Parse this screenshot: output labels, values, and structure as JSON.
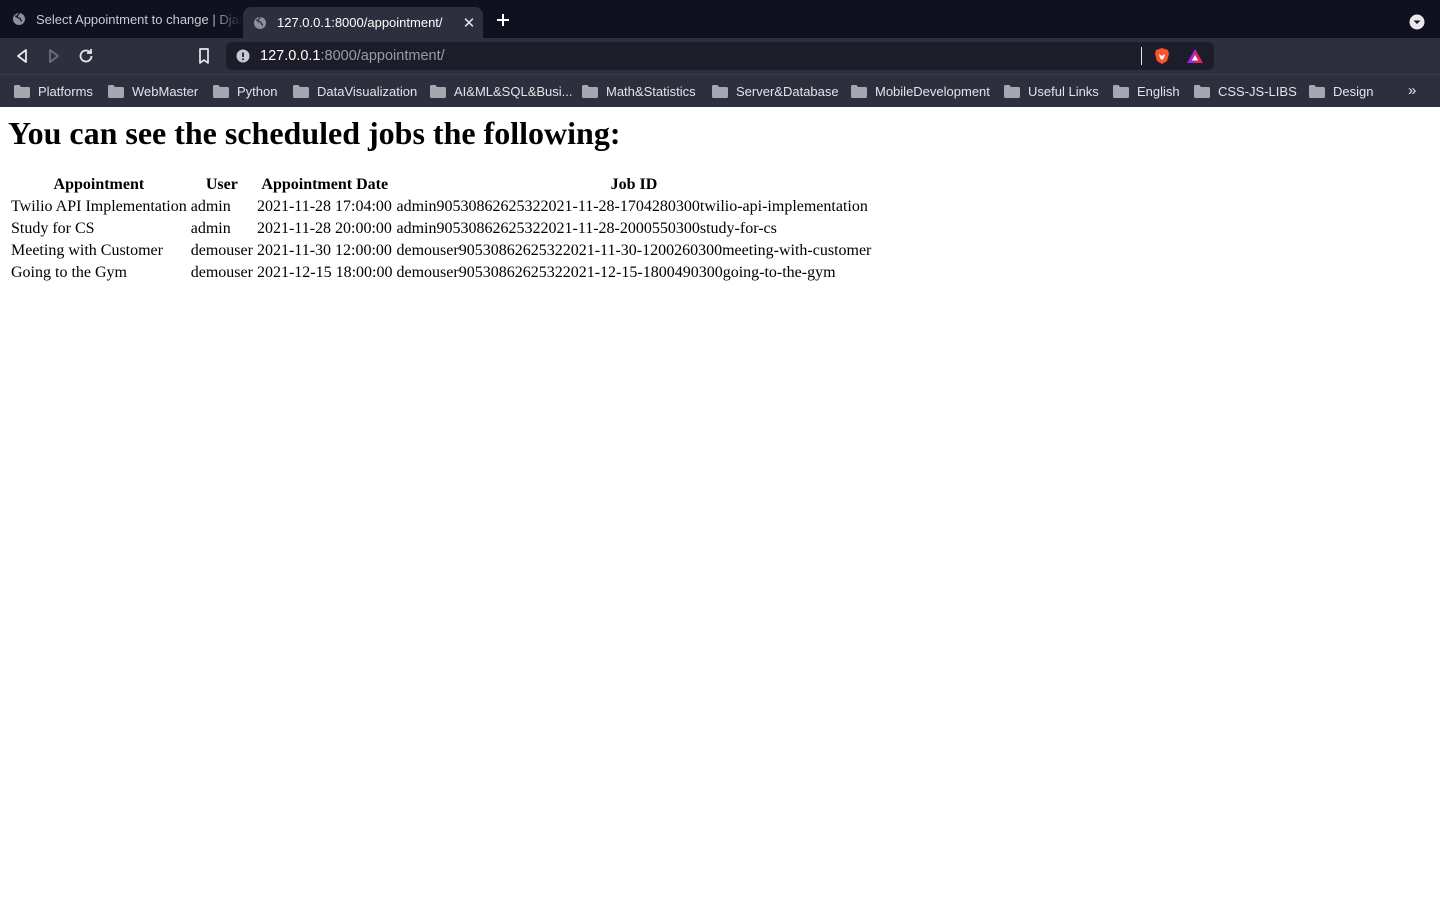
{
  "browser": {
    "tabs": [
      {
        "title": "Select Appointment to change | Django site admin",
        "active": false
      },
      {
        "title": "127.0.0.1:8000/appointment/",
        "active": true
      }
    ],
    "address": {
      "host": "127.0.0.1",
      "rest": ":8000/appointment/"
    },
    "bookmarks": [
      "Platforms",
      "WebMaster",
      "Python",
      "DataVisualization",
      "AI&ML&SQL&Busi...",
      "Math&Statistics",
      "Server&Database",
      "MobileDevelopment",
      "Useful Links",
      "English",
      "CSS-JS-LIBS",
      "Design"
    ],
    "colors": {
      "tabstrip": "#0f1020",
      "toolbar": "#2d2f3f",
      "omnibox": "#1c1d29",
      "brave_orange": "#fb542b"
    }
  },
  "page": {
    "heading": "You can see the scheduled jobs the following:",
    "table": {
      "headers": [
        "Appointment",
        "User",
        "Appointment Date",
        "Job ID"
      ],
      "rows": [
        [
          "Twilio API Implementation",
          "admin",
          "2021-11-28 17:04:00",
          "admin90530862625322021-11-28-1704280300twilio-api-implementation"
        ],
        [
          "Study for CS",
          "admin",
          "2021-11-28 20:00:00",
          "admin90530862625322021-11-28-2000550300study-for-cs"
        ],
        [
          "Meeting with Customer",
          "demouser",
          "2021-11-30 12:00:00",
          "demouser90530862625322021-11-30-1200260300meeting-with-customer"
        ],
        [
          "Going to the Gym",
          "demouser",
          "2021-12-15 18:00:00",
          "demouser90530862625322021-12-15-1800490300going-to-the-gym"
        ]
      ]
    }
  }
}
